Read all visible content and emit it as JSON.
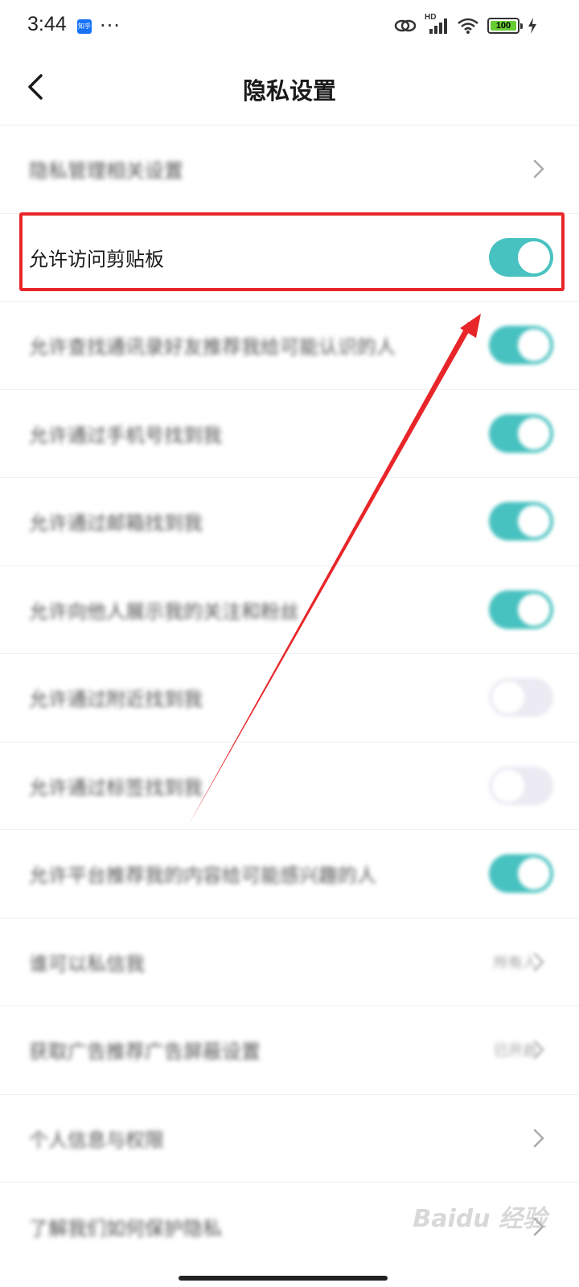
{
  "status_bar": {
    "time": "3:44",
    "app_badge": "知乎",
    "more": "···",
    "battery": "100",
    "network": "HD"
  },
  "header": {
    "title": "隐私设置",
    "back_icon": "chevron-left-icon"
  },
  "rows": [
    {
      "label": "隐私管理相关设置",
      "blurred": true,
      "control": "chevron"
    },
    {
      "label": "允许访问剪贴板",
      "blurred": false,
      "control": "toggle",
      "on": true,
      "highlighted": true
    },
    {
      "label": "允许查找通讯录好友推荐我给可能认识的人",
      "blurred": true,
      "control": "toggle",
      "on": true
    },
    {
      "label": "允许通过手机号找到我",
      "blurred": true,
      "control": "toggle",
      "on": true
    },
    {
      "label": "允许通过邮箱找到我",
      "blurred": true,
      "control": "toggle",
      "on": true
    },
    {
      "label": "允许向他人展示我的关注和粉丝",
      "blurred": true,
      "control": "toggle",
      "on": true
    },
    {
      "label": "允许通过附近找到我",
      "blurred": true,
      "control": "toggle",
      "on": false
    },
    {
      "label": "允许通过标签找到我",
      "blurred": true,
      "control": "toggle",
      "on": false
    },
    {
      "label": "允许平台推荐我的内容给可能感兴趣的人",
      "blurred": true,
      "control": "toggle",
      "on": true
    },
    {
      "label": "谁可以私信我",
      "blurred": true,
      "control": "value",
      "value": "所有人"
    },
    {
      "label": "获取广告推荐广告屏蔽设置",
      "blurred": true,
      "control": "value",
      "value": "已开启"
    },
    {
      "label": "个人信息与权限",
      "blurred": true,
      "control": "chevron"
    },
    {
      "label": "了解我们如何保护隐私",
      "blurred": true,
      "control": "chevron"
    }
  ],
  "watermark": "Baidu 经验",
  "colors": {
    "toggle_on": "#48c2c0",
    "toggle_off": "#eceaf2",
    "highlight": "#e8262a",
    "arrow": "#e8262a"
  }
}
